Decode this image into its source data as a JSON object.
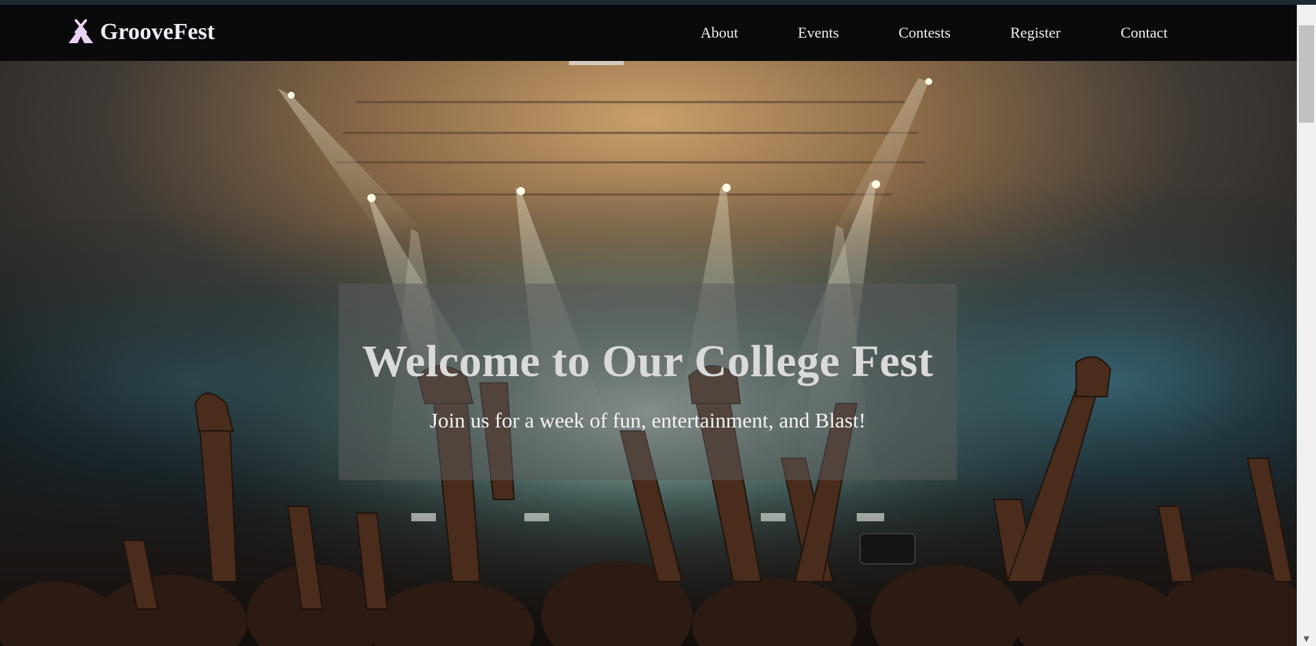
{
  "brand": {
    "name": "GrooveFest",
    "icon": "tent-icon"
  },
  "nav": {
    "items": [
      {
        "label": "About"
      },
      {
        "label": "Events"
      },
      {
        "label": "Contests"
      },
      {
        "label": "Register"
      },
      {
        "label": "Contact"
      }
    ]
  },
  "hero": {
    "title": "Welcome to Our College Fest",
    "subtitle": "Join us for a week of fun, entertainment, and Blast!",
    "background": "concert-crowd-stage-lights-image"
  },
  "colors": {
    "navbar_bg": "#0a090c",
    "nav_text": "#f2f2f2",
    "banner_bg": "rgba(90,90,90,0.55)",
    "title_text": "#dadada"
  }
}
